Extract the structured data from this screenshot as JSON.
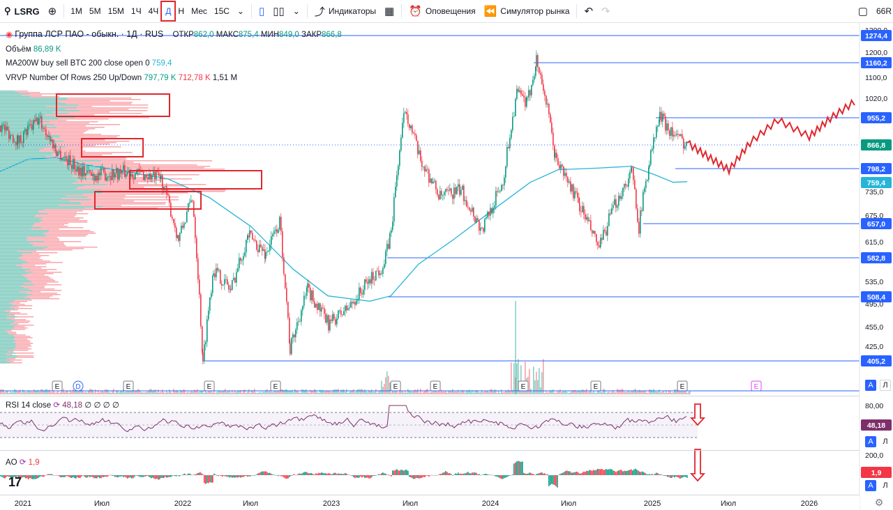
{
  "toolbar": {
    "symbol": "LSRG",
    "intervals": [
      "1М",
      "5М",
      "15М",
      "1Ч",
      "4Ч",
      "Д",
      "Н",
      "Мес",
      "15С"
    ],
    "active_interval": "Д",
    "indicators_label": "Индикаторы",
    "alerts_label": "Оповещения",
    "replay_label": "Симулятор рынка",
    "right_text": "66R"
  },
  "legend": {
    "title": "Группа ЛСР ПАО - обыкн. · 1Д · RUS",
    "o_label": "ОТКР",
    "o_val": "862,0",
    "h_label": "МАКС",
    "h_val": "875,4",
    "l_label": "МИН",
    "l_val": "849,0",
    "c_label": "ЗАКР",
    "c_val": "866,8",
    "volume_label": "Объём",
    "volume_val": "86,89 K",
    "ma_label": "MA200W buy sell BTC 200 close open 0",
    "ma_val": "759,4",
    "vrvp_label": "VRVP Number Of Rows 250 Up/Down",
    "vrvp_up": "797,79 K",
    "vrvp_down": "712,78 K",
    "vrvp_total": "1,51 M"
  },
  "rsi": {
    "label": "RSI 14 close",
    "value": "48,18",
    "extra": "∅ ∅ ∅ ∅",
    "scale": [
      "80,00",
      "48,18"
    ]
  },
  "ao": {
    "label": "AO",
    "value": "1,9",
    "scale": [
      "200,0",
      "1,9"
    ]
  },
  "price_scale": [
    "1300,0",
    "1200,0",
    "1100,0",
    "1020,0",
    "735,0",
    "675,0",
    "615,0",
    "535,0",
    "495,0",
    "455,0",
    "425,0"
  ],
  "price_labels": [
    {
      "text": "1274,4",
      "style": "line"
    },
    {
      "text": "1160,2",
      "style": "line"
    },
    {
      "text": "955,2",
      "style": "line"
    },
    {
      "text": "866,8",
      "style": "current"
    },
    {
      "text": "798,2",
      "style": "line"
    },
    {
      "text": "759,4",
      "style": "ma"
    },
    {
      "text": "657,0",
      "style": "line"
    },
    {
      "text": "582,8",
      "style": "line"
    },
    {
      "text": "508,4",
      "style": "line"
    },
    {
      "text": "405,2",
      "style": "line"
    }
  ],
  "time_axis": [
    "2021",
    "Июл",
    "2022",
    "Июл",
    "2023",
    "Июл",
    "2024",
    "Июл",
    "2025",
    "Июл",
    "2026"
  ],
  "event_markers": [
    "E",
    "D",
    "E",
    "E",
    "E",
    "E",
    "E",
    "E",
    "E",
    "E",
    "E"
  ],
  "colors": {
    "up": "#089981",
    "down": "#f23645",
    "ma": "#26b5d9",
    "hline": "#2962ff",
    "rsi": "#7e2f6b",
    "annot": "#e0262c"
  },
  "auto_label": "A",
  "log_label": "Л",
  "logo": "17"
}
